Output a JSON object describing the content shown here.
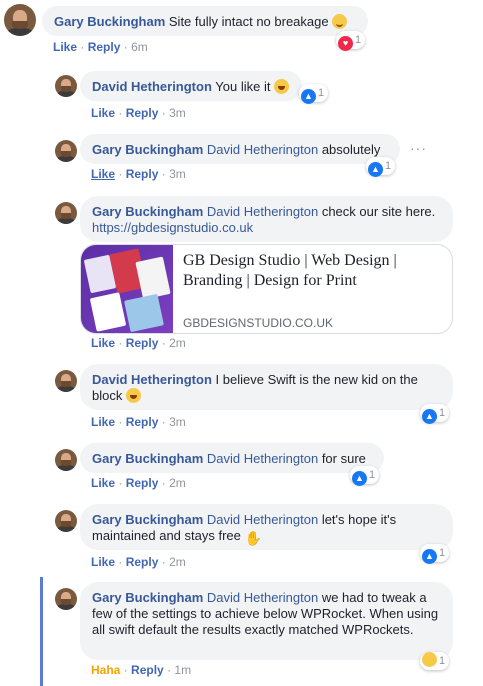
{
  "comments": [
    {
      "author": "Gary Buckingham",
      "mention": "",
      "text": "Site fully intact no breakage",
      "emoji": "smile",
      "like": "Like",
      "reply": "Reply",
      "time": "6m",
      "reaction_count": "1",
      "reaction": "love"
    },
    {
      "author": "David Hetherington",
      "mention": "",
      "text": "You like it",
      "emoji": "laugh",
      "like": "Like",
      "reply": "Reply",
      "time": "3m",
      "reaction_count": "1",
      "reaction": "like"
    },
    {
      "author": "Gary Buckingham",
      "mention": "David Hetherington",
      "text": "absolutely",
      "like": "Like",
      "reply": "Reply",
      "time": "3m",
      "reaction_count": "1",
      "reaction": "like",
      "menu": "···"
    },
    {
      "author": "Gary Buckingham",
      "mention": "David Hetherington",
      "text": "check our site here.",
      "link": "https://gbdesignstudio.co.uk",
      "like": "Like",
      "reply": "Reply",
      "time": "2m",
      "preview": {
        "title": "GB Design Studio | Web Design | Branding | Design for Print",
        "domain": "GBDESIGNSTUDIO.CO.UK"
      }
    },
    {
      "author": "David Hetherington",
      "mention": "",
      "text": "I believe Swift is the new kid on the block",
      "emoji": "laugh",
      "like": "Like",
      "reply": "Reply",
      "time": "3m",
      "reaction_count": "1",
      "reaction": "like"
    },
    {
      "author": "Gary Buckingham",
      "mention": "David Hetherington",
      "text": "for sure",
      "like": "Like",
      "reply": "Reply",
      "time": "2m",
      "reaction_count": "1",
      "reaction": "like"
    },
    {
      "author": "Gary Buckingham",
      "mention": "David Hetherington",
      "text": "let's hope it's maintained and stays free",
      "emoji": "raised-hands",
      "like": "Like",
      "reply": "Reply",
      "time": "2m",
      "reaction_count": "1",
      "reaction": "like"
    },
    {
      "author": "Gary Buckingham",
      "mention": "David Hetherington",
      "text": "we had to tweak a few of the settings to achieve below WPRocket. When using all swift default the results exactly matched WPRockets.",
      "like": "Haha",
      "reply": "Reply",
      "time": "1m",
      "reaction_count": "1",
      "reaction": "haha"
    }
  ],
  "separator": "·",
  "colors": {
    "link": "#385898",
    "action": "#4267b2",
    "bubble": "#f2f3f5",
    "meta": "#90949c",
    "haha": "#f5a300",
    "thread": "#5b7bd5"
  }
}
